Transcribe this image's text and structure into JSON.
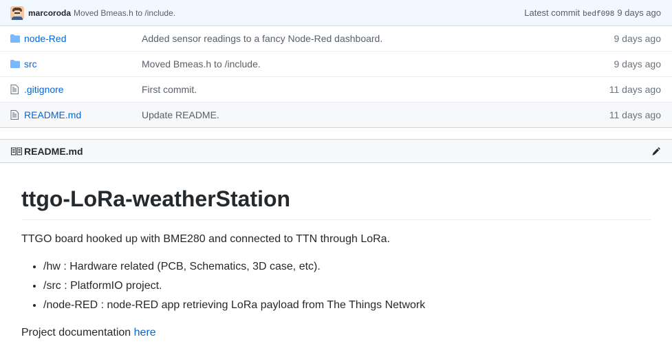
{
  "latest_commit": {
    "author": "marcoroda",
    "message": "Moved Bmeas.h to /include.",
    "label": "Latest commit",
    "sha": "bedf098",
    "age": "9 days ago"
  },
  "files": [
    {
      "type": "folder",
      "name": "node-Red",
      "message": "Added sensor readings to a fancy Node-Red dashboard.",
      "age": "9 days ago"
    },
    {
      "type": "folder",
      "name": "src",
      "message": "Moved Bmeas.h to /include.",
      "age": "9 days ago"
    },
    {
      "type": "file",
      "name": ".gitignore",
      "message": "First commit.",
      "age": "11 days ago"
    },
    {
      "type": "file",
      "name": "README.md",
      "message": "Update README.",
      "age": "11 days ago"
    }
  ],
  "readme": {
    "filename": "README.md",
    "title": "ttgo-LoRa-weatherStation",
    "intro": "TTGO board hooked up with BME280 and connected to TTN through LoRa.",
    "items": [
      "/hw : Hardware related (PCB, Schematics, 3D case, etc).",
      "/src : PlatformIO project.",
      "/node-RED : node-RED app retrieving LoRa payload from The Things Network"
    ],
    "doc_text": "Project documentation",
    "doc_link": "here"
  },
  "colors": {
    "link": "#0366d6",
    "commit_bar_bg": "#f1f8ff",
    "icon_gray": "#6a737d",
    "folder": "#79b8ff"
  }
}
